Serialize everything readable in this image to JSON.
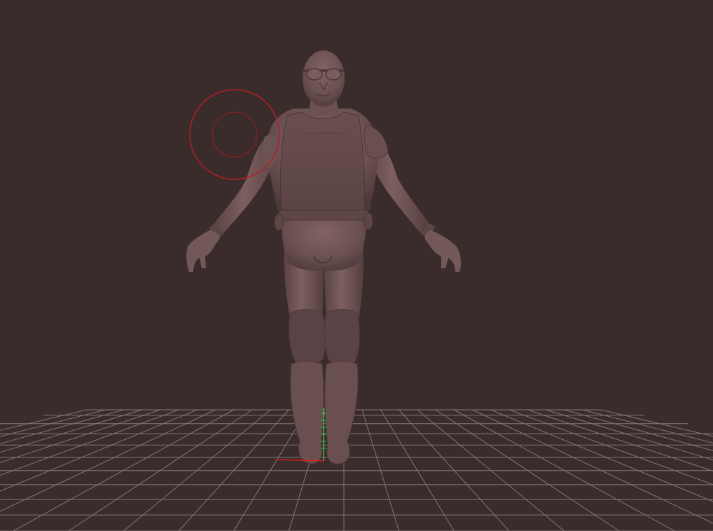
{
  "canvas": {
    "background_color": "#3b2c2c",
    "model_color": "#6e5253",
    "grid_color": "#8f8487",
    "brush_color": "#b51e24",
    "axis_x_color": "#d81c1c",
    "axis_y_color": "#39c13c"
  },
  "scene": {
    "model": "humanoid-character-a-pose",
    "accessories": [
      "goggles",
      "vest",
      "belt",
      "kneepads",
      "boots",
      "wrist-bands"
    ],
    "floor_grid": true,
    "draw_brush_cursor": true,
    "gizmo_axes": [
      "x",
      "y"
    ]
  }
}
